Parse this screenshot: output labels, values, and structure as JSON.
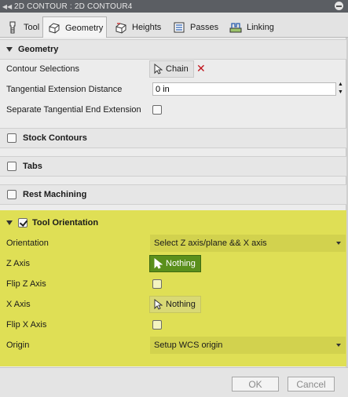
{
  "window": {
    "title": "2D CONTOUR : 2D CONTOUR4"
  },
  "tabs": [
    {
      "label": "Tool",
      "icon": "tool-icon"
    },
    {
      "label": "Geometry",
      "icon": "geometry-icon"
    },
    {
      "label": "Heights",
      "icon": "heights-icon"
    },
    {
      "label": "Passes",
      "icon": "passes-icon"
    },
    {
      "label": "Linking",
      "icon": "linking-icon"
    }
  ],
  "geometry": {
    "header": "Geometry",
    "contour_selections_label": "Contour Selections",
    "chain_button": "Chain",
    "tangential_extension_label": "Tangential Extension Distance",
    "tangential_extension_value": "0 in",
    "separate_tangential_label": "Separate Tangential End Extension",
    "separate_tangential_checked": false
  },
  "stock_contours": {
    "label": "Stock Contours",
    "checked": false
  },
  "tabs_section": {
    "label": "Tabs",
    "checked": false
  },
  "rest_machining": {
    "label": "Rest Machining",
    "checked": false
  },
  "tool_orientation": {
    "label": "Tool Orientation",
    "checked": true,
    "orientation_label": "Orientation",
    "orientation_value": "Select Z axis/plane && X axis",
    "z_axis_label": "Z Axis",
    "z_axis_value": "Nothing",
    "flip_z_label": "Flip Z Axis",
    "flip_z_checked": false,
    "x_axis_label": "X Axis",
    "x_axis_value": "Nothing",
    "flip_x_label": "Flip X Axis",
    "flip_x_checked": false,
    "origin_label": "Origin",
    "origin_value": "Setup WCS origin"
  },
  "footer": {
    "ok_label": "OK",
    "cancel_label": "Cancel"
  },
  "colors": {
    "highlight": "#dfdf55",
    "active_selection": "#5a8f1c",
    "remove_x": "#c0141c"
  }
}
